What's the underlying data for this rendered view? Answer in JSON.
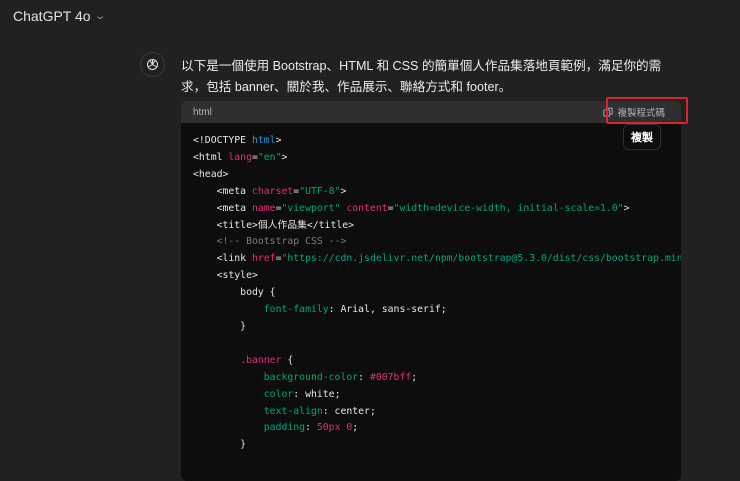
{
  "header": {
    "model": "ChatGPT 4o"
  },
  "message": {
    "text": "以下是一個使用 Bootstrap、HTML 和 CSS 的簡單個人作品集落地頁範例，滿足你的需求，包括 banner、關於我、作品展示、聯絡方式和 footer。"
  },
  "code": {
    "language": "html",
    "copy_label": "複製程式碼",
    "tooltip": "複製",
    "lines": [
      [
        [
          "p",
          "<!DOCTYPE "
        ],
        [
          "k",
          "html"
        ],
        [
          "p",
          ">"
        ]
      ],
      [
        [
          "p",
          "<html "
        ],
        [
          "a",
          "lang"
        ],
        [
          "p",
          "="
        ],
        [
          "s",
          "\"en\""
        ],
        [
          "p",
          ">"
        ]
      ],
      [
        [
          "p",
          "<head>"
        ]
      ],
      [
        [
          "p",
          "    <meta "
        ],
        [
          "a",
          "charset"
        ],
        [
          "p",
          "="
        ],
        [
          "s",
          "\"UTF-8\""
        ],
        [
          "p",
          ">"
        ]
      ],
      [
        [
          "p",
          "    <meta "
        ],
        [
          "a",
          "name"
        ],
        [
          "p",
          "="
        ],
        [
          "s",
          "\"viewport\""
        ],
        [
          "p",
          " "
        ],
        [
          "a",
          "content"
        ],
        [
          "p",
          "="
        ],
        [
          "s",
          "\"width=device-width, initial-scale=1.0\""
        ],
        [
          "p",
          ">"
        ]
      ],
      [
        [
          "p",
          "    <title>個人作品集</title>"
        ]
      ],
      [
        [
          "c",
          "    <!-- Bootstrap CSS -->"
        ]
      ],
      [
        [
          "p",
          "    <link "
        ],
        [
          "a",
          "href"
        ],
        [
          "p",
          "="
        ],
        [
          "s",
          "\"https://cdn.jsdelivr.net/npm/bootstrap@5.3.0/dist/css/bootstrap.min"
        ]
      ],
      [
        [
          "p",
          "    <style>"
        ]
      ],
      [
        [
          "p",
          "        body {"
        ]
      ],
      [
        [
          "p",
          "            "
        ],
        [
          "s",
          "font-family"
        ],
        [
          "p",
          ": Arial, sans-serif;"
        ]
      ],
      [
        [
          "p",
          "        }"
        ]
      ],
      [
        [
          "p",
          " "
        ]
      ],
      [
        [
          "p",
          "        "
        ],
        [
          "n",
          ".banner"
        ],
        [
          "p",
          " {"
        ]
      ],
      [
        [
          "p",
          "            "
        ],
        [
          "s",
          "background-color"
        ],
        [
          "p",
          ": "
        ],
        [
          "n",
          "#007bff"
        ],
        [
          "p",
          ";"
        ]
      ],
      [
        [
          "p",
          "            "
        ],
        [
          "s",
          "color"
        ],
        [
          "p",
          ": white;"
        ]
      ],
      [
        [
          "p",
          "            "
        ],
        [
          "s",
          "text-align"
        ],
        [
          "p",
          ": center;"
        ]
      ],
      [
        [
          "p",
          "            "
        ],
        [
          "s",
          "padding"
        ],
        [
          "p",
          ": "
        ],
        [
          "n",
          "50px 0"
        ],
        [
          "p",
          ";"
        ]
      ],
      [
        [
          "p",
          "        }"
        ]
      ]
    ]
  }
}
